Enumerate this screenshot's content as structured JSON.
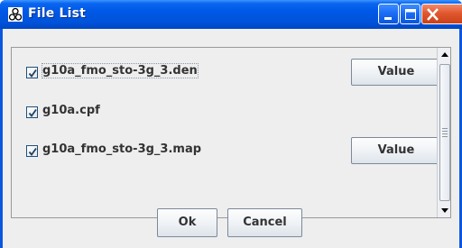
{
  "window": {
    "title": "File List",
    "icon": "molecule-icon",
    "controls": [
      "minimize-icon",
      "maximize-icon",
      "close-icon"
    ]
  },
  "files": [
    {
      "name": "g10a_fmo_sto-3g_3.den",
      "checked": true,
      "has_value_button": true,
      "value_label": "Value"
    },
    {
      "name": "g10a.cpf",
      "checked": true,
      "has_value_button": false
    },
    {
      "name": "g10a_fmo_sto-3g_3.map",
      "checked": true,
      "has_value_button": true,
      "value_label": "Value"
    }
  ],
  "buttons": {
    "ok_label": "Ok",
    "cancel_label": "Cancel"
  },
  "colors": {
    "titlebar": "#0058e6",
    "close_button": "#e2582e",
    "panel_background": "#eeeeee"
  }
}
